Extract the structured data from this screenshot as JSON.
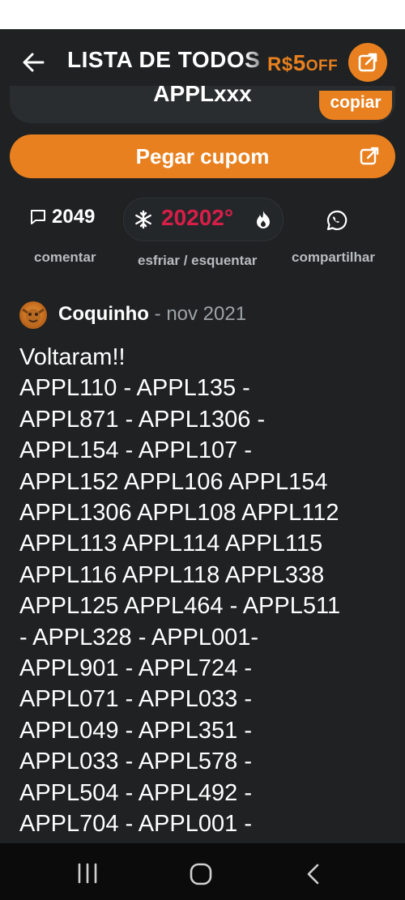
{
  "header": {
    "title": "LISTA DE TODOS",
    "promo_currency": "R$",
    "promo_amount": "5",
    "promo_suffix": "OFF"
  },
  "coupon": {
    "code": "APPLxxx",
    "copy_label": "copiar",
    "get_label": "Pegar cupom"
  },
  "stats": {
    "comments_count": "2049",
    "comment_label": "comentar",
    "temperature": "20202°",
    "temp_label": "esfriar / esquentar",
    "share_label": "compartilhar"
  },
  "post": {
    "author": "Coquinho",
    "separator": "-",
    "date": "nov 2021",
    "body": "Voltaram!!\nAPPL110 - APPL135 -\nAPPL871 - APPL1306 -\nAPPL154 - APPL107 -\nAPPL152 APPL106 APPL154\nAPPL1306 APPL108 APPL112\nAPPL113 APPL114 APPL115\nAPPL116 APPL118 APPL338\nAPPL125 APPL464 - APPL511\n- APPL328 - APPL001-\nAPPL901 - APPL724 -\nAPPL071 - APPL033 -\nAPPL049 - APPL351 -\nAPPL033 - APPL578 -\nAPPL504 - APPL492 -\nAPPL704 - APPL001 -"
  },
  "icons": {
    "back": "arrow-left-icon",
    "external": "external-link-icon",
    "comment": "comment-icon",
    "snowflake": "snowflake-icon",
    "flame": "flame-icon",
    "share": "whatsapp-icon"
  },
  "colors": {
    "accent": "#e8801f",
    "hot": "#d81e48",
    "background": "#1f2122"
  }
}
